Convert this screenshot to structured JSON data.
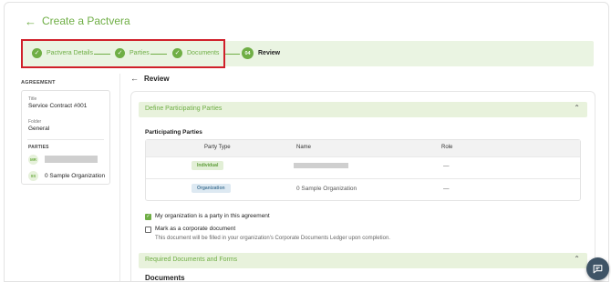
{
  "header": {
    "title": "Create a Pactvera",
    "back_icon": "arrow-left-icon"
  },
  "stepper": {
    "steps": [
      {
        "label": "Pactvera Details",
        "state": "done"
      },
      {
        "label": "Parties",
        "state": "done"
      },
      {
        "label": "Documents",
        "state": "done"
      },
      {
        "number": "04",
        "label": "Review",
        "state": "current"
      }
    ],
    "highlight_color": "#d0202a"
  },
  "sidebar": {
    "heading": "AGREEMENT",
    "title_label": "Title",
    "title_value": "Service Contract #001",
    "folder_label": "Folder",
    "folder_value": "General",
    "parties_heading": "PARTIES",
    "parties": [
      {
        "initials": "MR",
        "name": ""
      },
      {
        "initials": "0S",
        "name": "0 Sample Organization"
      }
    ]
  },
  "main": {
    "title": "Review",
    "section1": {
      "title": "Define Participating Parties",
      "subheading": "Participating Parties",
      "columns": [
        "Party Type",
        "Name",
        "Role"
      ],
      "rows": [
        {
          "type": "Individual",
          "name": "",
          "role": "—"
        },
        {
          "type": "Organization",
          "name": "0 Sample Organization",
          "role": "—"
        }
      ],
      "checkbox1": {
        "label": "My organization is a party in this agreement",
        "checked": true
      },
      "checkbox2": {
        "label": "Mark as a corporate document",
        "checked": false
      },
      "note": "This document will be filled in your organization's Corporate Documents Ledger upon completion."
    },
    "section2": {
      "title": "Required Documents and Forms",
      "subheading": "Documents"
    }
  },
  "colors": {
    "accent": "#6fae45",
    "accent_bg": "#eaf4e2",
    "chat": "#3f5466"
  }
}
